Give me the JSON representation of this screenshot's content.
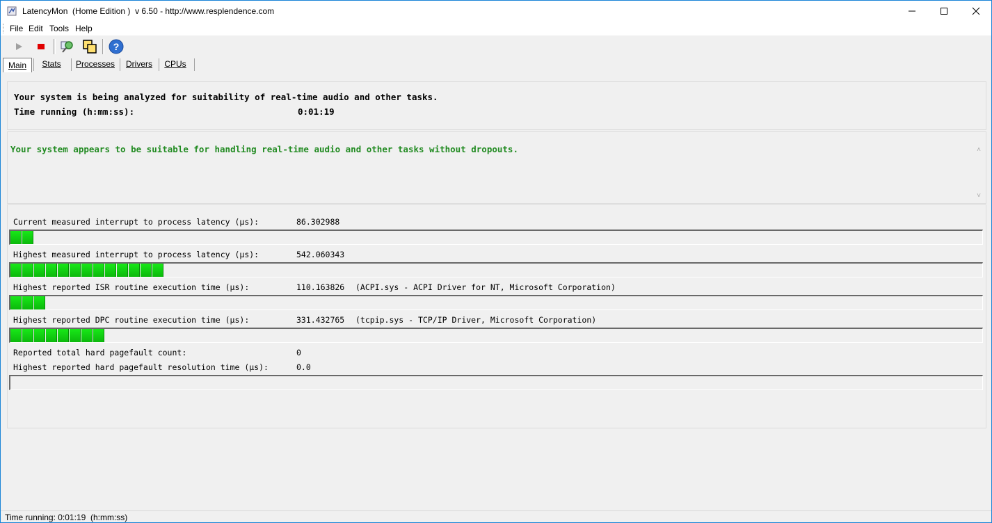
{
  "window": {
    "title": "LatencyMon  (Home Edition )  v 6.50 - http://www.resplendence.com"
  },
  "menu": [
    "File",
    "Edit",
    "Tools",
    "Help"
  ],
  "toolbar": {
    "icons": [
      "play-icon",
      "stop-icon",
      "find-icon",
      "windows-icon",
      "help-icon"
    ]
  },
  "tabs": [
    "Main",
    "Stats",
    "Processes",
    "Drivers",
    "CPUs"
  ],
  "analysis": {
    "message": "Your system is being analyzed for suitability of real-time audio and other tasks.",
    "time_label": "Time running (h:mm:ss):",
    "time_value": "0:01:19"
  },
  "verdict": {
    "text": "Your system appears to be suitable for handling real-time audio and other tasks without dropouts.",
    "color": "#228b22"
  },
  "metrics": [
    {
      "label": "Current measured interrupt to process latency (µs):",
      "value": "86.302988",
      "extra": "",
      "bar_segments": 2
    },
    {
      "label": "Highest measured interrupt to process latency (µs):",
      "value": "542.060343",
      "extra": "",
      "bar_segments": 13
    },
    {
      "label": "Highest reported ISR routine execution time (µs):",
      "value": "110.163826",
      "extra": "(ACPI.sys - ACPI Driver for NT, Microsoft Corporation)",
      "bar_segments": 3
    },
    {
      "label": "Highest reported DPC routine execution time (µs):",
      "value": "331.432765",
      "extra": "(tcpip.sys - TCP/IP Driver, Microsoft Corporation)",
      "bar_segments": 8
    }
  ],
  "pagefault": {
    "count_label": "Reported total hard pagefault count:",
    "count_value": "0",
    "time_label": "Highest reported hard pagefault resolution time (µs):",
    "time_value": "0.0",
    "bar_segments": 0
  },
  "status": {
    "text": "Time running: 0:01:19  (h:mm:ss)"
  }
}
